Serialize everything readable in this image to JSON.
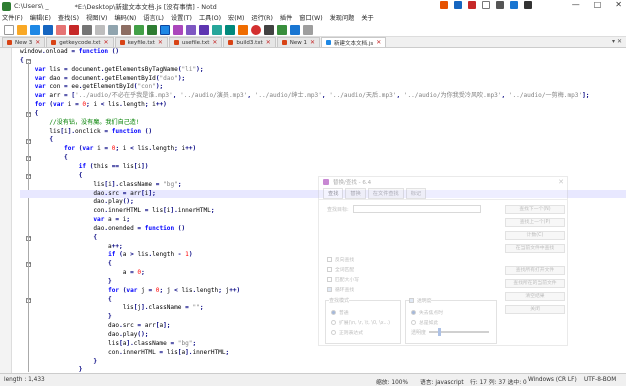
{
  "window": {
    "title_path": "C:\\Users\\ _",
    "title_full": "*E:\\Desktop\\新建文本文档.js [没有事情] - Notd",
    "controls": [
      "—",
      "□",
      "✕"
    ]
  },
  "menu": [
    "文件(F)",
    "编辑(E)",
    "查找(S)",
    "视图(V)",
    "编码(N)",
    "语言(L)",
    "设置(T)",
    "工具(O)",
    "宏(M)",
    "运行(R)",
    "插件",
    "窗口(W)",
    "发现问题",
    "关于"
  ],
  "tabs": [
    {
      "label": "New 3"
    },
    {
      "label": "getkeycode.txt"
    },
    {
      "label": "keyfile.txt"
    },
    {
      "label": "usefile.txt"
    },
    {
      "label": "build3.txt"
    },
    {
      "label": "New 1"
    },
    {
      "label": "新建文本文档.js",
      "active": true
    }
  ],
  "tab_right": "▾ ✕",
  "code_lines": [
    "window.onload = function ()",
    "{",
    "    var lis = document.getElementsByTagName(\"li\");",
    "    var dao = document.getElementById(\"dao\");",
    "    var con = ee.getElementById(\"con\");",
    "    var arr = ['../audio/不必在乎我是谁.mp3', '../audio/演员.mp3', '../audio/绅士.mp3', '../audio/天后.mp3', '../audio/为你我受冷风吹.mp3', '../audio/一剪梅.mp3'];",
    "    for (var i = 0; i < lis.length; i++)",
    "    {",
    "        //没有钻，没有魔。我们自己造!",
    "        lis[i].onclick = function ()",
    "        {",
    "            for (var i = 0; i < lis.length; i++)",
    "            {",
    "                if (this == lis[i])",
    "                {",
    "                    lis[i].className = \"bg\";",
    "                    dao.src = arr[i];",
    "                    dao.play();",
    "                    con.innerHTML = lis[i].innerHTML;",
    "                    var a = i;",
    "                    dao.onended = function ()",
    "                    {",
    "                        a++;",
    "                        if (a > lis.length - 1)",
    "                        {",
    "                            a = 0;",
    "                        }",
    "                        for (var j = 0; j < lis.length; j++)",
    "                        {",
    "                            lis[j].className = \"\";",
    "                        }",
    "                        dao.src = arr[a];",
    "                        dao.play();",
    "                        lis[a].className = \"bg\";",
    "                        con.innerHTML = lis[a].innerHTML;",
    "                    }",
    "                }",
    "            else",
    "            {",
    "                lis[i].cla"
  ],
  "dialog": {
    "title": "替换/查找 - 6.4",
    "tabs": [
      "查找",
      "替换",
      "在文件查找",
      "标记"
    ],
    "find_label": "查找目标:",
    "buttons": [
      "查找下一个(N)",
      "查找上一个(P)",
      "计数(C)",
      "在当前文件中查找",
      "查找所有打开文件",
      "查找所在的当前文件",
      "清空结果",
      "关闭"
    ],
    "checks": [
      "反向查找",
      "全词匹配",
      "匹配大小写",
      "循环查找"
    ],
    "search_mode_label": "查找模式",
    "modes": [
      "普通",
      "扩展(\\n, \\r, \\t, \\0, \\x...)",
      "正则表达式"
    ],
    "transparency_label": "透明度",
    "transparency_opts": [
      "失去焦点时",
      "总是如此"
    ],
    "transparency_level": 0.15
  },
  "status": {
    "length": "length : 1,433",
    "zoom": "缩放: 100%",
    "lang": "语言: javascript",
    "pos": "行: 17  列: 37  选中: 0",
    "eol": "Windows (CR LF)",
    "enc": "UTF-8-BOM"
  }
}
